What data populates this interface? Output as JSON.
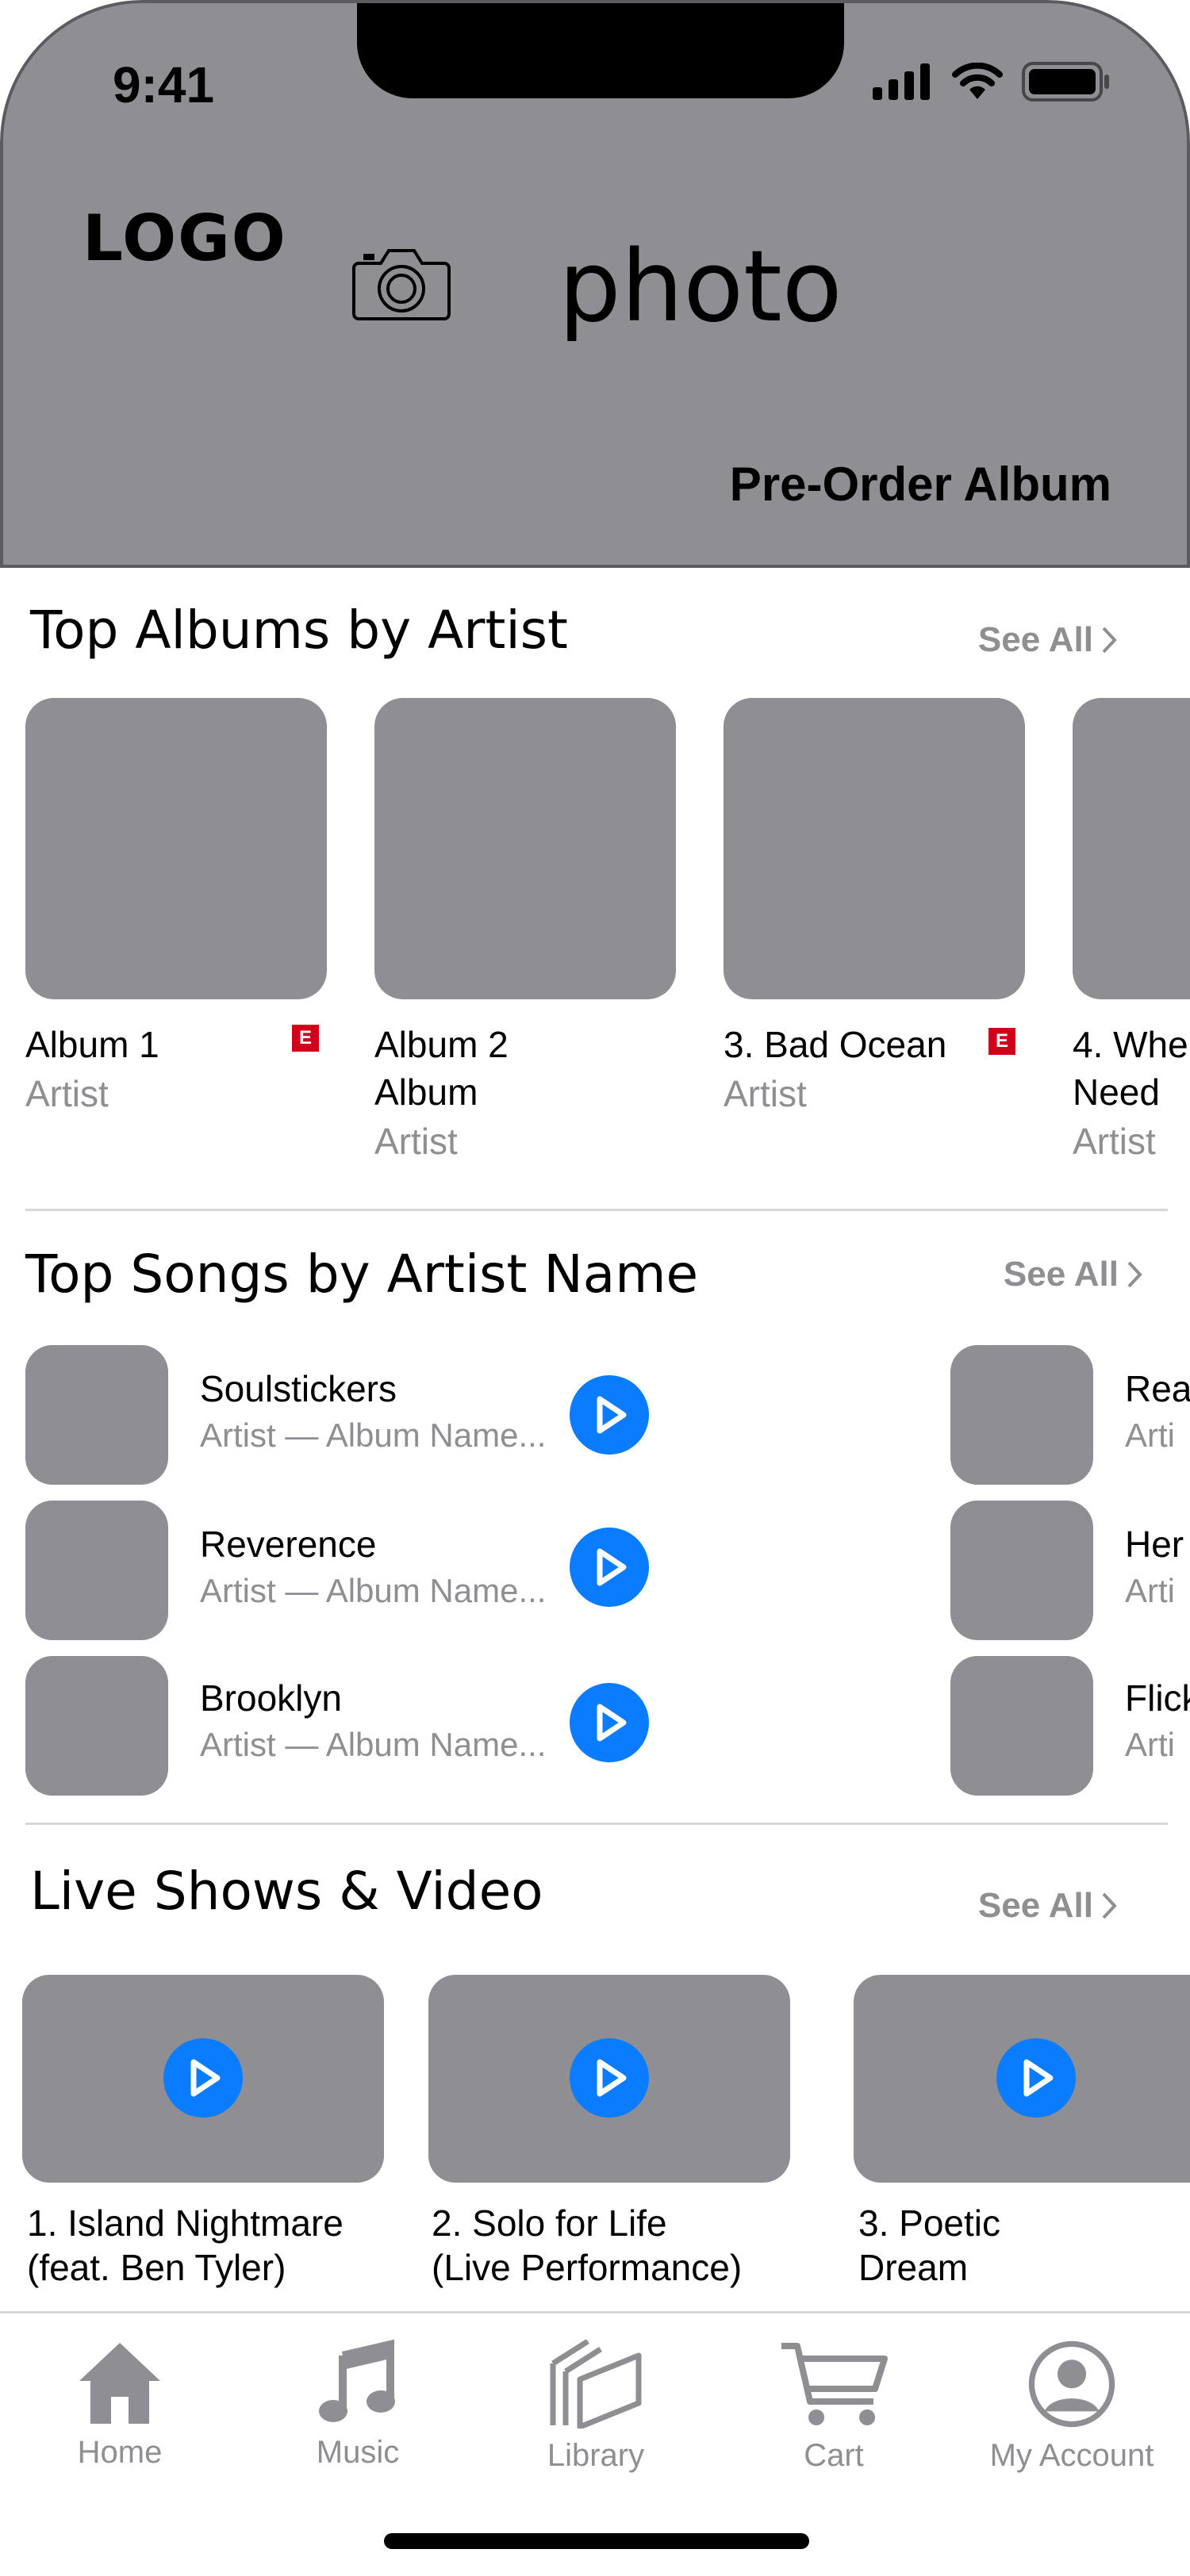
{
  "status_bar": {
    "time": "9:41"
  },
  "header": {
    "logo": "LOGO",
    "photo_label": "photo",
    "preorder_label": "Pre-Order Album",
    "icons": [
      "camera-icon",
      "signal-icon",
      "wifi-icon",
      "battery-icon"
    ]
  },
  "top_albums": {
    "title": "Top Albums by Artist",
    "see_all": "See All",
    "items": [
      {
        "line1": "Album 1",
        "line2": "Artist",
        "line3": "",
        "explicit": "E"
      },
      {
        "line1": "Album 2",
        "line2": "Album",
        "line3": "Artist",
        "explicit": ""
      },
      {
        "line1": "3. Bad Ocean",
        "line2": "Artist",
        "line3": "",
        "explicit": "E"
      },
      {
        "line1": "4. Whe",
        "line2": "Need",
        "line3": "Artist",
        "explicit": ""
      }
    ]
  },
  "top_songs": {
    "title": "Top Songs by Artist Name",
    "see_all": "See All",
    "items": [
      {
        "title": "Soulstickers",
        "subtitle": "Artist — Album Name..."
      },
      {
        "title": "Reverence",
        "subtitle": "Artist — Album Name..."
      },
      {
        "title": "Brooklyn",
        "subtitle": "Artist — Album Name..."
      }
    ],
    "peek_items": [
      {
        "title": "Rea",
        "subtitle": "Arti"
      },
      {
        "title": "Her",
        "subtitle": "Arti"
      },
      {
        "title": "Flick",
        "subtitle": "Arti"
      }
    ]
  },
  "live_shows": {
    "title": "Live Shows & Video",
    "see_all": "See All",
    "items": [
      {
        "line1": "1. Island Nightmare",
        "line2": "(feat. Ben Tyler)"
      },
      {
        "line1": "2. Solo for Life",
        "line2": "(Live Performance)"
      },
      {
        "line1": "3. Poetic",
        "line2": "Dream"
      }
    ]
  },
  "tab_bar": {
    "items": [
      {
        "label": "Home",
        "icon": "home-icon"
      },
      {
        "label": "Music",
        "icon": "music-note-icon"
      },
      {
        "label": "Library",
        "icon": "library-icon"
      },
      {
        "label": "Cart",
        "icon": "cart-icon"
      },
      {
        "label": "My Account",
        "icon": "account-icon"
      }
    ]
  },
  "colors": {
    "placeholder_gray": "#8e8e93",
    "accent_blue": "#0a7cff",
    "explicit_red": "#d0021b"
  }
}
